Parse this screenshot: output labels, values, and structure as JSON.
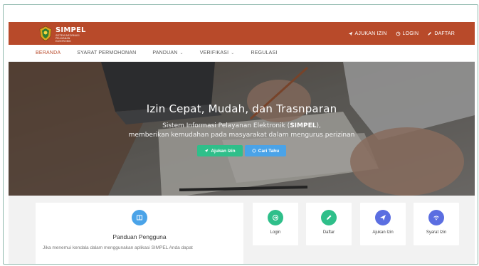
{
  "header": {
    "brand_title": "SIMPEL",
    "brand_subtitle": "SISTEM INFORMASI PELAYANAN ELEKTRONIK",
    "links": [
      {
        "label": "AJUKAN IZIN",
        "icon": "send-icon"
      },
      {
        "label": "LOGIN",
        "icon": "login-icon"
      },
      {
        "label": "DAFTAR",
        "icon": "pencil-icon"
      }
    ],
    "color": "#b84a2a"
  },
  "nav": {
    "items": [
      {
        "label": "BERANDA",
        "active": true
      },
      {
        "label": "SYARAT PERMOHONAN"
      },
      {
        "label": "PANDUAN",
        "dropdown": true
      },
      {
        "label": "VERIFIKASI",
        "dropdown": true
      },
      {
        "label": "REGULASI"
      }
    ],
    "chevron": "⌄"
  },
  "hero": {
    "title": "Izin Cepat, Mudah, dan Trasnparan",
    "sub_line1_prefix": "Sistem Informasi Pelayanan Elektronik (",
    "sub_line1_bold": "SIMPEL",
    "sub_line1_suffix": "),",
    "sub_line2": "memberikan kemudahan pada masyarakat dalam mengurus perizinan",
    "btn_apply": "Ajukan Izin",
    "btn_search": "Cari Tahu"
  },
  "guide": {
    "title": "Panduan Pengguna",
    "text": "Jika menemui kendala dalam menggunakan aplikasi SIMPEL Anda dapat"
  },
  "quick_cards": [
    {
      "label": "Login",
      "icon": "login-icon",
      "color": "#2fbf8a"
    },
    {
      "label": "Daftar",
      "icon": "pencil-icon",
      "color": "#2fbf8a"
    },
    {
      "label": "Ajukan Izin",
      "icon": "send-icon",
      "color": "#5b6ee1"
    },
    {
      "label": "Syarat Izin",
      "icon": "wifi-icon",
      "color": "#5b6ee1"
    }
  ]
}
